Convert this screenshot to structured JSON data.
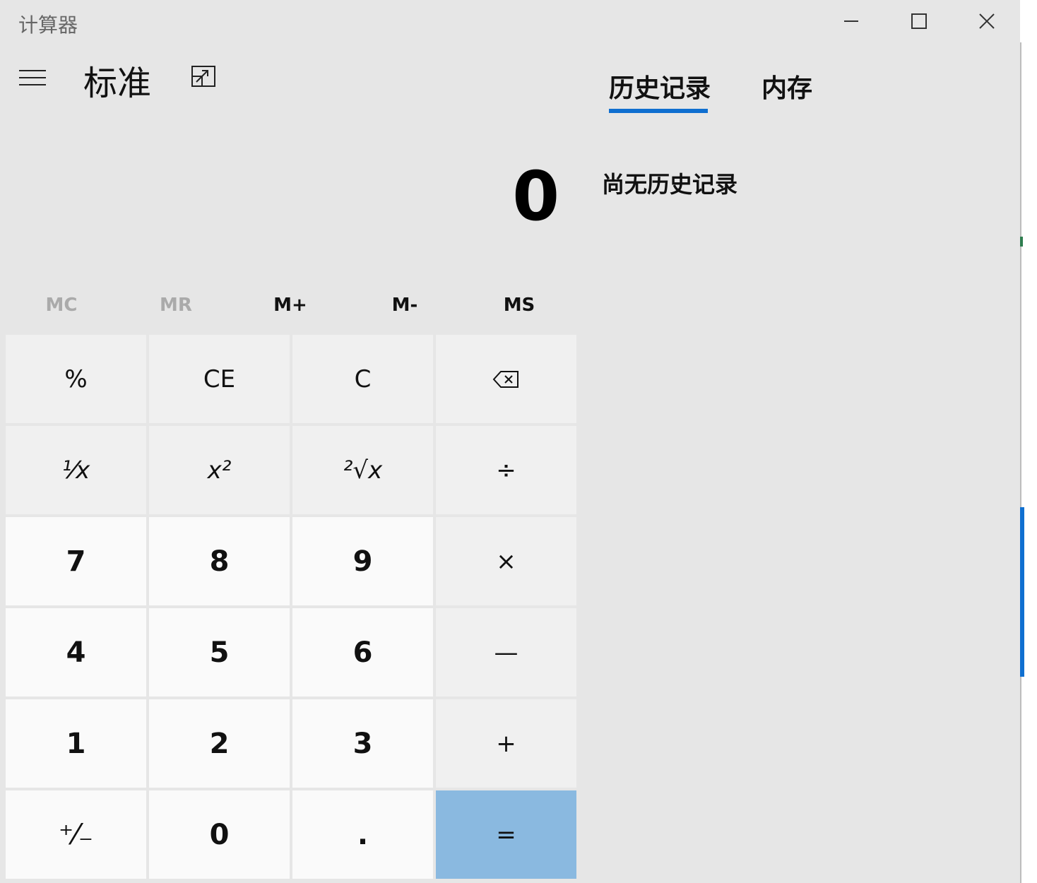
{
  "window": {
    "title": "计算器",
    "controls": [
      "minimize-icon",
      "maximize-icon",
      "close-icon"
    ]
  },
  "header": {
    "menu_icon": "hamburger-icon",
    "mode": "标准",
    "keep_on_top_icon": "keep-on-top-icon"
  },
  "display": {
    "value": "0"
  },
  "memory": {
    "mc": "MC",
    "mr": "MR",
    "m_plus": "M+",
    "m_minus": "M-",
    "ms": "MS"
  },
  "keys": {
    "percent": "%",
    "ce": "CE",
    "c": "C",
    "backspace_icon": "backspace-icon",
    "reciprocal": "¹⁄x",
    "square": "x²",
    "sqrt": "²√x",
    "divide": "÷",
    "seven": "7",
    "eight": "8",
    "nine": "9",
    "multiply": "×",
    "four": "4",
    "five": "5",
    "six": "6",
    "minus": "—",
    "one": "1",
    "two": "2",
    "three": "3",
    "plus": "+",
    "negate": "⁺⁄₋",
    "zero": "0",
    "decimal": ".",
    "equals": "="
  },
  "history_panel": {
    "tabs": [
      "历史记录",
      "内存"
    ],
    "active_tab": "历史记录",
    "empty_message": "尚无历史记录"
  },
  "colors": {
    "window_bg": "#e6e6e6",
    "fn_key_bg": "#f0f0f0",
    "num_key_bg": "#fafafa",
    "equals_bg": "#8ab9e0",
    "accent": "#0f6fd0",
    "disabled_text": "#aaaaaa"
  }
}
